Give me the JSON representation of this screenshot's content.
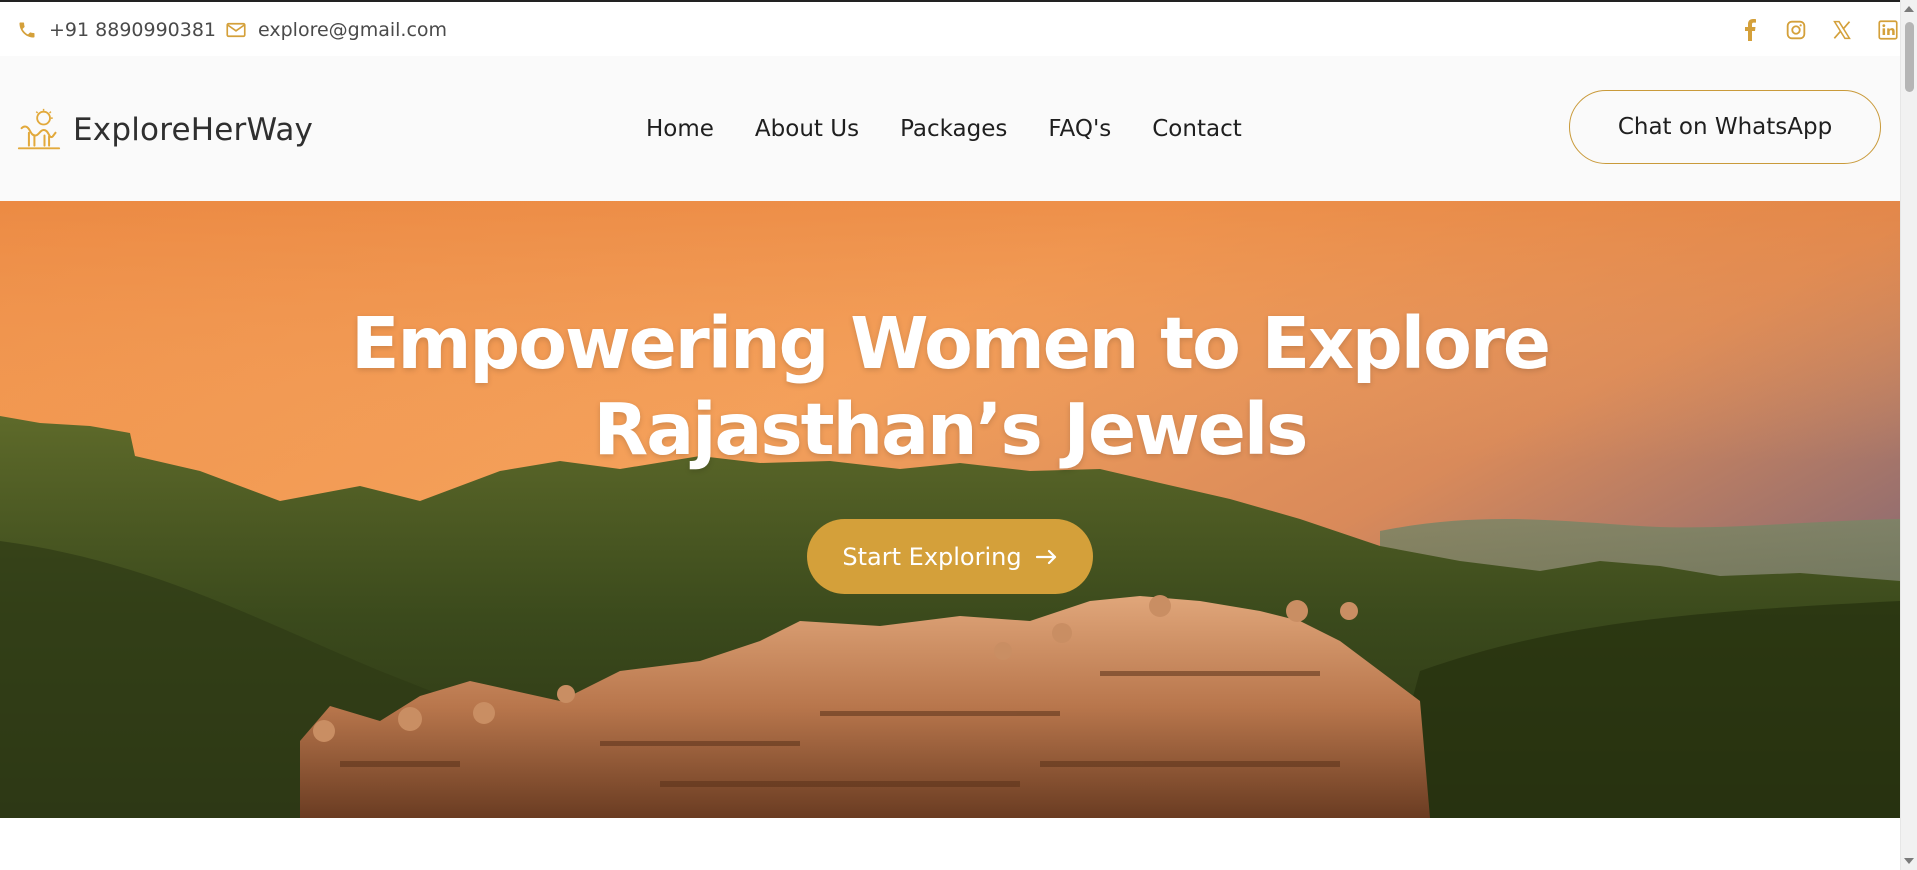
{
  "topbar": {
    "phone": "+91 8890990381",
    "email": "explore@gmail.com",
    "socials": [
      "facebook-icon",
      "instagram-icon",
      "x-icon",
      "linkedin-icon"
    ]
  },
  "header": {
    "logo_text": "ExploreHerWay",
    "nav": [
      "Home",
      "About Us",
      "Packages",
      "FAQ's",
      "Contact"
    ],
    "cta": "Chat on WhatsApp"
  },
  "hero": {
    "title_line1": "Empowering Women to Explore",
    "title_line2": "Rajasthan’s Jewels",
    "button_label": "Start Exploring"
  },
  "colors": {
    "accent": "#d4a03a",
    "text_dark": "#1f1f1f",
    "header_bg": "#fafafa"
  }
}
